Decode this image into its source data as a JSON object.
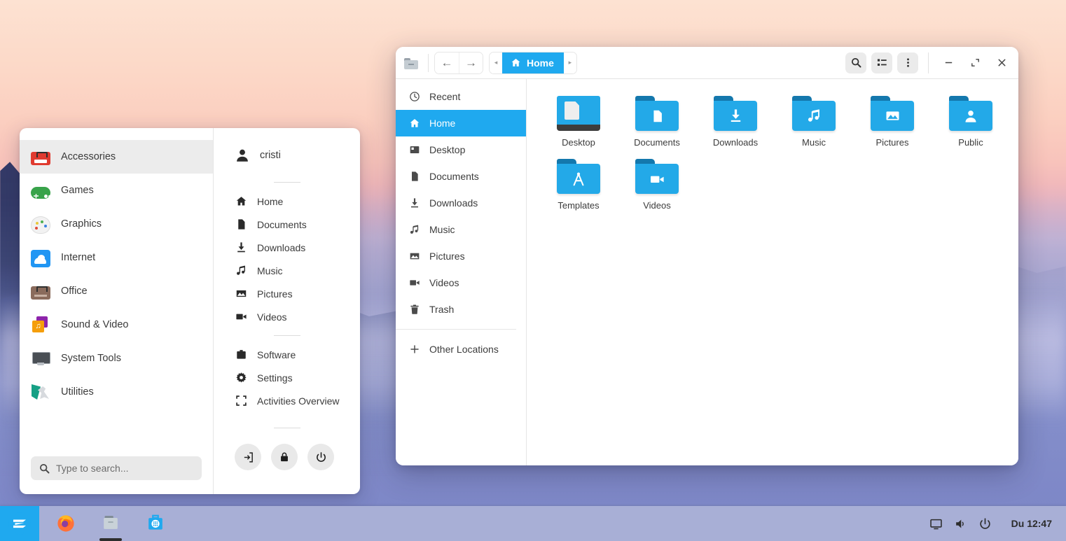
{
  "desktop": {
    "wallpaper_name": "mountain-sunrise-wallpaper",
    "colors": {
      "accent": "#1fa9ef",
      "taskbar": "#a8afd6",
      "sky_top": "#fde2d2",
      "sky_bottom": "#7c85c4"
    }
  },
  "app_menu": {
    "categories": [
      {
        "label": "Accessories",
        "icon": "toolbox-icon",
        "active": true
      },
      {
        "label": "Games",
        "icon": "gamepad-icon",
        "active": false
      },
      {
        "label": "Graphics",
        "icon": "palette-icon",
        "active": false
      },
      {
        "label": "Internet",
        "icon": "cloud-icon",
        "active": false
      },
      {
        "label": "Office",
        "icon": "briefcase-icon",
        "active": false
      },
      {
        "label": "Sound & Video",
        "icon": "music-video-icon",
        "active": false
      },
      {
        "label": "System Tools",
        "icon": "monitor-icon",
        "active": false
      },
      {
        "label": "Utilities",
        "icon": "tools-icon",
        "active": false
      }
    ],
    "search": {
      "placeholder": "Type to search...",
      "value": "",
      "icon": "search-icon"
    },
    "user": {
      "name": "cristi",
      "icon": "user-avatar-icon"
    },
    "places": [
      {
        "label": "Home",
        "icon": "home-icon"
      },
      {
        "label": "Documents",
        "icon": "document-icon"
      },
      {
        "label": "Downloads",
        "icon": "download-icon"
      },
      {
        "label": "Music",
        "icon": "music-note-icon"
      },
      {
        "label": "Pictures",
        "icon": "image-icon"
      },
      {
        "label": "Videos",
        "icon": "video-camera-icon"
      }
    ],
    "system": [
      {
        "label": "Software",
        "icon": "software-bag-icon"
      },
      {
        "label": "Settings",
        "icon": "gear-icon"
      },
      {
        "label": "Activities Overview",
        "icon": "activities-frame-icon"
      }
    ],
    "power_buttons": [
      {
        "name": "log-out-button",
        "icon": "logout-icon"
      },
      {
        "name": "lock-button",
        "icon": "lock-icon"
      },
      {
        "name": "power-button",
        "icon": "power-icon"
      }
    ]
  },
  "file_manager": {
    "header": {
      "app_icon": "folder-app-icon",
      "back_label": "←",
      "forward_label": "→",
      "path_prev": "◂",
      "path_next": "▸",
      "current_path": "Home",
      "path_icon": "home-icon",
      "search_icon": "search-icon",
      "view_icon": "list-view-icon",
      "menu_icon": "kebab-menu-icon",
      "minimize": "−",
      "maximize": "maximize-icon",
      "close": "✕"
    },
    "sidebar": [
      {
        "label": "Recent",
        "icon": "clock-icon",
        "active": false
      },
      {
        "label": "Home",
        "icon": "home-icon",
        "active": true
      },
      {
        "label": "Desktop",
        "icon": "desktop-icon",
        "active": false
      },
      {
        "label": "Documents",
        "icon": "document-icon",
        "active": false
      },
      {
        "label": "Downloads",
        "icon": "download-icon",
        "active": false
      },
      {
        "label": "Music",
        "icon": "music-note-icon",
        "active": false
      },
      {
        "label": "Pictures",
        "icon": "image-icon",
        "active": false
      },
      {
        "label": "Videos",
        "icon": "video-camera-icon",
        "active": false
      },
      {
        "label": "Trash",
        "icon": "trash-icon",
        "active": false
      }
    ],
    "other_locations": {
      "label": "Other Locations",
      "icon": "plus-icon"
    },
    "files": [
      {
        "label": "Desktop",
        "kind": "desktop-folder"
      },
      {
        "label": "Documents",
        "kind": "folder",
        "glyph": "document-icon"
      },
      {
        "label": "Downloads",
        "kind": "folder",
        "glyph": "download-icon"
      },
      {
        "label": "Music",
        "kind": "folder",
        "glyph": "music-note-icon"
      },
      {
        "label": "Pictures",
        "kind": "folder",
        "glyph": "image-icon"
      },
      {
        "label": "Public",
        "kind": "folder",
        "glyph": "person-icon"
      },
      {
        "label": "Templates",
        "kind": "folder",
        "glyph": "compass-icon"
      },
      {
        "label": "Videos",
        "kind": "folder",
        "glyph": "video-camera-icon"
      }
    ]
  },
  "taskbar": {
    "start_button": {
      "name": "zorin-menu-button",
      "icon": "zorin-logo-icon"
    },
    "tasks": [
      {
        "name": "firefox",
        "icon": "firefox-icon",
        "running": false
      },
      {
        "name": "files",
        "icon": "file-manager-icon",
        "running": true
      },
      {
        "name": "software",
        "icon": "software-store-icon",
        "running": false
      }
    ],
    "tray": [
      {
        "name": "display-settings",
        "icon": "display-icon"
      },
      {
        "name": "volume",
        "icon": "speaker-icon"
      },
      {
        "name": "power-menu",
        "icon": "power-icon"
      }
    ],
    "clock": "Du 12:47"
  }
}
